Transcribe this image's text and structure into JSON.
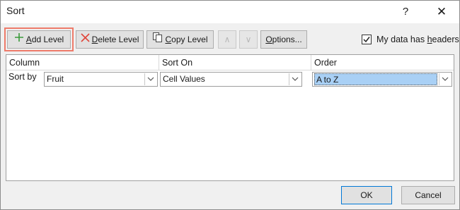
{
  "window": {
    "title": "Sort",
    "help_label": "?",
    "close_label": "✕"
  },
  "toolbar": {
    "add_level": {
      "underline": "A",
      "rest": "dd Level"
    },
    "delete_level": {
      "underline": "D",
      "rest": "elete Level"
    },
    "copy_level": {
      "underline": "C",
      "rest": "opy Level"
    },
    "move_up": "∧",
    "move_down": "∨",
    "options": {
      "underline": "O",
      "rest": "ptions..."
    },
    "highlight_color": "#ee7b6a"
  },
  "headers_checkbox": {
    "checked": true,
    "label_pre": "My data has ",
    "label_underline": "h",
    "label_post": "eaders"
  },
  "grid": {
    "columns": [
      "Column",
      "Sort On",
      "Order"
    ],
    "row_label": "Sort by",
    "row": {
      "column": "Fruit",
      "sort_on": "Cell Values",
      "order": "A to Z"
    }
  },
  "footer": {
    "ok": "OK",
    "cancel": "Cancel"
  }
}
